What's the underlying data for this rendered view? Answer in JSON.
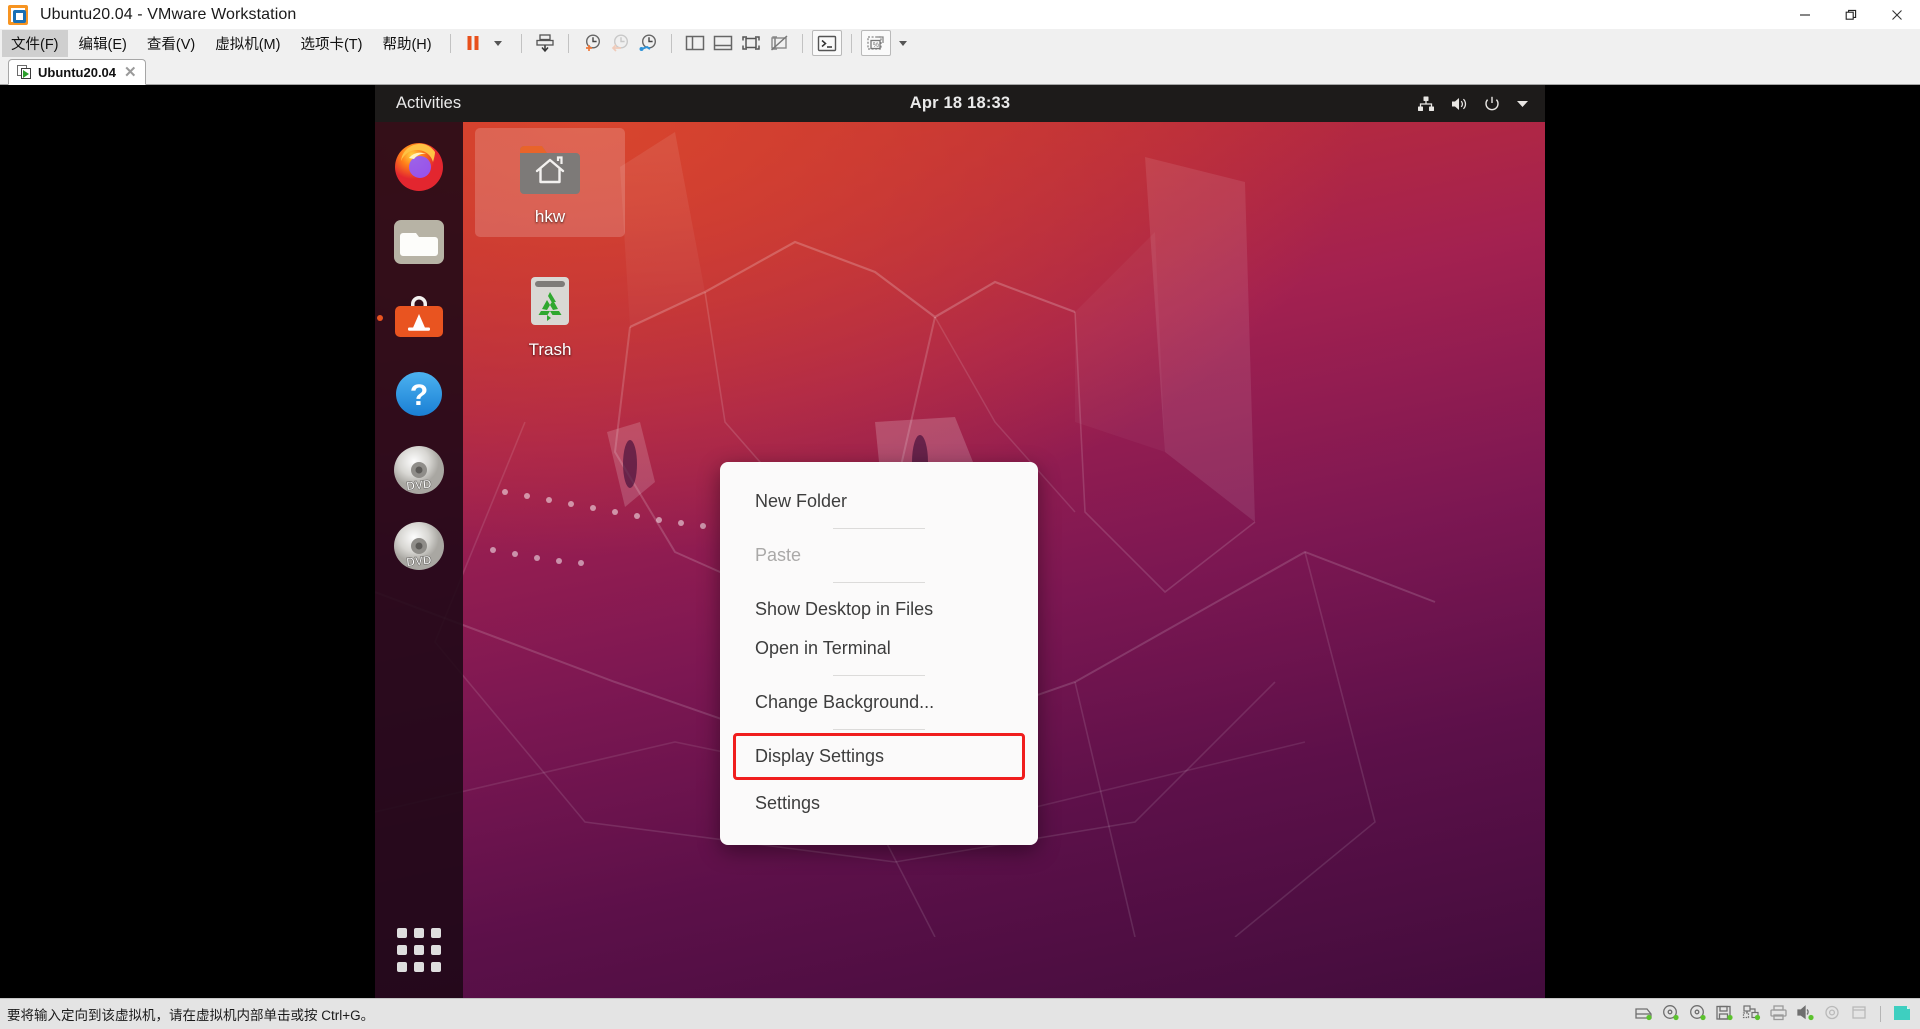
{
  "window": {
    "title": "Ubuntu20.04 - VMware Workstation",
    "minimize_label": "─",
    "restore_label": "❐",
    "close_label": "✕"
  },
  "menubar": {
    "items": [
      {
        "label": "文件(F)",
        "active": true
      },
      {
        "label": "编辑(E)",
        "active": false
      },
      {
        "label": "查看(V)",
        "active": false
      },
      {
        "label": "虚拟机(M)",
        "active": false
      },
      {
        "label": "选项卡(T)",
        "active": false
      },
      {
        "label": "帮助(H)",
        "active": false
      }
    ]
  },
  "toolbar": {
    "buttons": [
      {
        "name": "suspend-button",
        "icon": "pause-icon"
      },
      {
        "name": "power-dropdown",
        "icon": "chevron-down-icon"
      },
      {
        "name": "send-ctrl-alt-del-button",
        "icon": "send-key-icon"
      },
      {
        "name": "take-snapshot-button",
        "icon": "snapshot-add-icon"
      },
      {
        "name": "revert-snapshot-button",
        "icon": "snapshot-revert-icon"
      },
      {
        "name": "snapshot-manager-button",
        "icon": "snapshot-manage-icon"
      },
      {
        "name": "show-library-button",
        "icon": "panel-left-icon"
      },
      {
        "name": "show-thumbnail-bar-button",
        "icon": "panel-bottom-icon"
      },
      {
        "name": "full-screen-button",
        "icon": "fullscreen-icon"
      },
      {
        "name": "unity-mode-button",
        "icon": "unity-mode-icon"
      },
      {
        "name": "console-button",
        "icon": "terminal-icon"
      },
      {
        "name": "remote-console-button",
        "icon": "remote-console-icon"
      },
      {
        "name": "remote-console-dropdown",
        "icon": "chevron-down-icon"
      }
    ]
  },
  "tabs": [
    {
      "label": "Ubuntu20.04",
      "close_label": "✕",
      "active": true
    }
  ],
  "guest": {
    "topbar": {
      "activities": "Activities",
      "clock": "Apr 18  18:33",
      "tray": [
        {
          "name": "network-wired-icon"
        },
        {
          "name": "volume-icon"
        },
        {
          "name": "power-icon"
        },
        {
          "name": "chevron-down-icon"
        }
      ]
    },
    "dock": {
      "items": [
        {
          "name": "dock-item-firefox",
          "icon": "firefox-icon",
          "running": false
        },
        {
          "name": "dock-item-files",
          "icon": "files-folder-icon",
          "running": false
        },
        {
          "name": "dock-item-ubuntu-software",
          "icon": "ubuntu-software-icon",
          "running": true
        },
        {
          "name": "dock-item-help",
          "icon": "help-question-icon",
          "running": false
        },
        {
          "name": "dock-item-dvd-1",
          "icon": "dvd-disc-icon",
          "running": false
        },
        {
          "name": "dock-item-dvd-2",
          "icon": "dvd-disc-icon",
          "running": false
        }
      ],
      "show_applications_label": "Show Applications"
    },
    "desktop_icons": [
      {
        "name": "desktop-icon-home",
        "label": "hkw",
        "icon": "home-folder-icon",
        "selected": true
      },
      {
        "name": "desktop-icon-trash",
        "label": "Trash",
        "icon": "trash-icon",
        "selected": false
      }
    ],
    "context_menu": {
      "items": [
        {
          "label": "New Folder",
          "type": "item",
          "disabled": false,
          "highlighted": false
        },
        {
          "label": "",
          "type": "separator"
        },
        {
          "label": "Paste",
          "type": "item",
          "disabled": true,
          "highlighted": false
        },
        {
          "label": "",
          "type": "separator"
        },
        {
          "label": "Show Desktop in Files",
          "type": "item",
          "disabled": false,
          "highlighted": false
        },
        {
          "label": "Open in Terminal",
          "type": "item",
          "disabled": false,
          "highlighted": false
        },
        {
          "label": "",
          "type": "separator"
        },
        {
          "label": "Change Background...",
          "type": "item",
          "disabled": false,
          "highlighted": false
        },
        {
          "label": "",
          "type": "separator"
        },
        {
          "label": "Display Settings",
          "type": "item",
          "disabled": false,
          "highlighted": true
        },
        {
          "label": "Settings",
          "type": "item",
          "disabled": false,
          "highlighted": false
        }
      ],
      "highlight_color": "#f01d1d"
    }
  },
  "statusbar": {
    "message": "要将输入定向到该虚拟机，请在虚拟机内部单击或按 Ctrl+G。",
    "devices": [
      {
        "name": "status-hard-disk-icon"
      },
      {
        "name": "status-cdrom-1-icon"
      },
      {
        "name": "status-cdrom-2-icon"
      },
      {
        "name": "status-floppy-icon"
      },
      {
        "name": "status-network-icon"
      },
      {
        "name": "status-printer-icon"
      },
      {
        "name": "status-sound-icon"
      },
      {
        "name": "status-camera-icon"
      },
      {
        "name": "status-usb-icon"
      },
      {
        "name": "status-message-icon"
      }
    ]
  },
  "colors": {
    "vmware_orange": "#f79421",
    "vmware_blue": "#1a6fb4",
    "ubuntu_orange": "#e95420",
    "highlight_red": "#f01d1d",
    "gnome_bar": "#1d1b1a"
  }
}
